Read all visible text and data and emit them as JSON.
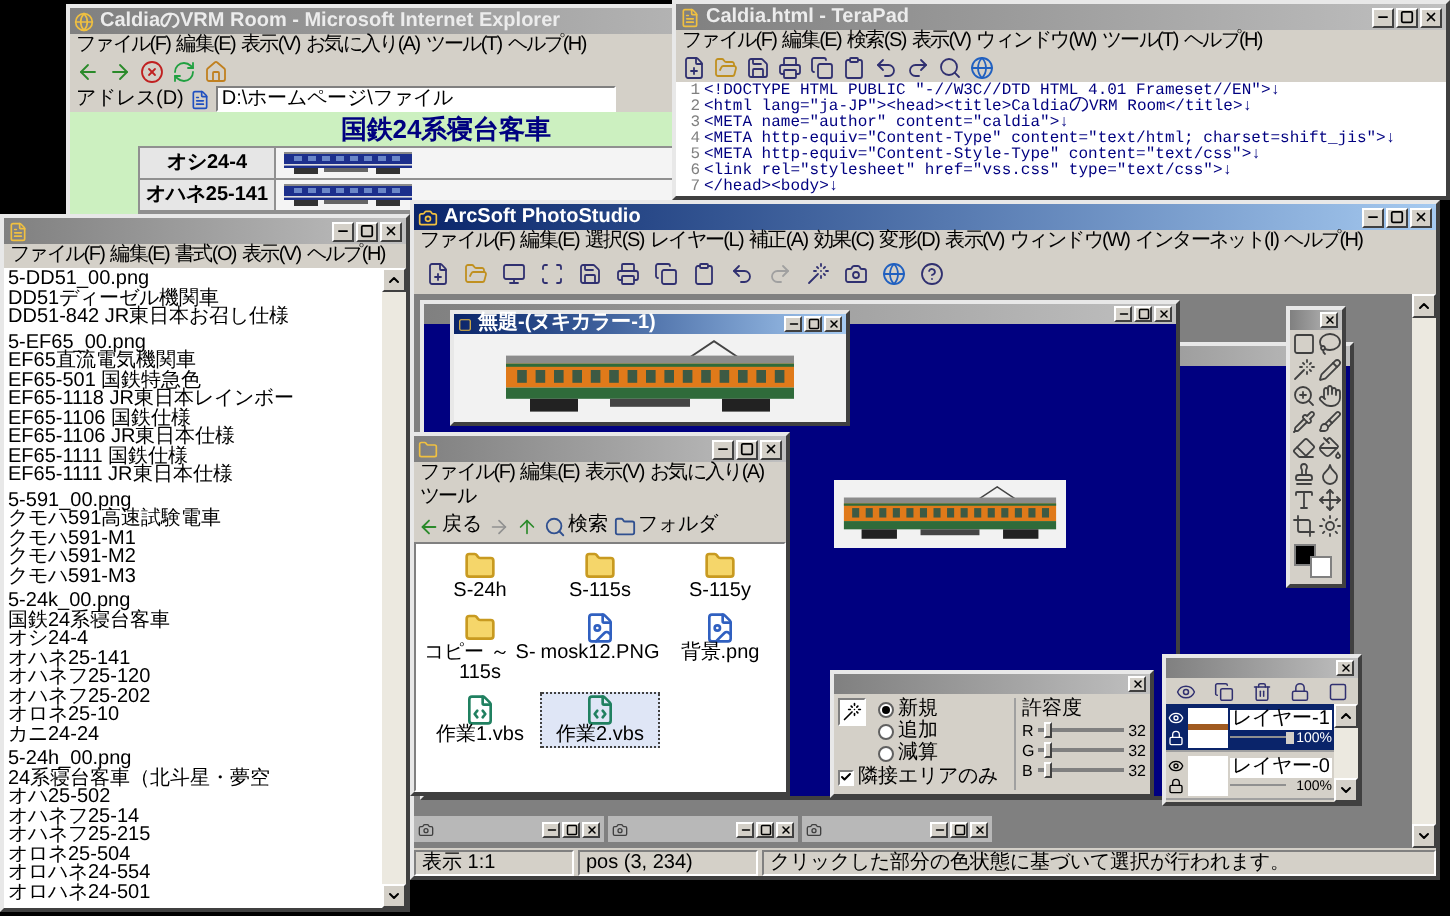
{
  "ie": {
    "title": "CaldiaのVRM Room - Microsoft Internet Explorer",
    "active": false,
    "menu": [
      "ファイル(F)",
      "編集(E)",
      "表示(V)",
      "お気に入り(A)",
      "ツール(T)",
      "ヘルプ(H)"
    ],
    "address_label": "アドレス(D)",
    "address": "D:\\ホームページ\\ファイル",
    "heading": "国鉄24系寝台客車",
    "rows": [
      {
        "label": "オシ24-4"
      },
      {
        "label": "オハネ25-141"
      }
    ]
  },
  "terapad": {
    "title": "Caldia.html - TeraPad",
    "active": false,
    "menu": [
      "ファイル(F)",
      "編集(E)",
      "検索(S)",
      "表示(V)",
      "ウィンドウ(W)",
      "ツール(T)",
      "ヘルプ(H)"
    ],
    "lines": [
      {
        "number": "1",
        "text": "<!DOCTYPE HTML PUBLIC \"-//W3C//DTD HTML 4.01 Frameset//EN\">↓"
      },
      {
        "number": "2",
        "text": "<html lang=\"ja-JP\"><head><title>CaldiaのVRM Room</title>↓"
      },
      {
        "number": "3",
        "text": "<META name=\"author\" content=\"caldia\">↓"
      },
      {
        "number": "4",
        "text": "<META http-equiv=\"Content-Type\" content=\"text/html; charset=shift_jis\">↓"
      },
      {
        "number": "5",
        "text": "<META http-equiv=\"Content-Style-Type\" content=\"text/css\">↓"
      },
      {
        "number": "6",
        "text": "<link rel=\"stylesheet\" href=\"vss.css\" type=\"text/css\">↓"
      },
      {
        "number": "7",
        "text": "</head><body>↓"
      }
    ]
  },
  "notepad": {
    "active": false,
    "menu": [
      "ファイル(F)",
      "編集(E)",
      "書式(O)",
      "表示(V)",
      "ヘルプ(H)"
    ],
    "sections": [
      [
        "5-DD51_00.png",
        "DD51ディーゼル機関車",
        "DD51-842 JR東日本お召し仕様"
      ],
      [
        "5-EF65_00.png",
        "EF65直流電気機関車",
        "EF65-501 国鉄特急色",
        "EF65-1118 JR東日本レインボー",
        "EF65-1106 国鉄仕様",
        "EF65-1106 JR東日本仕様",
        "EF65-1111 国鉄仕様",
        "EF65-1111 JR東日本仕様"
      ],
      [
        "5-591_00.png",
        "クモハ591高速試験電車",
        "クモハ591-M1",
        "クモハ591-M2",
        "クモハ591-M3"
      ],
      [
        "5-24k_00.png",
        "国鉄24系寝台客車",
        "オシ24-4",
        "オハネ25-141",
        "オハネフ25-120",
        "オハネフ25-202",
        "オロネ25-10",
        "カニ24-24"
      ],
      [
        "5-24h_00.png",
        "24系寝台客車（北斗星・夢空",
        "オハ25-502",
        "オハネフ25-14",
        "オハネフ25-215",
        "オロネ25-504",
        "オロハネ24-554",
        "オロハネ24-501"
      ]
    ]
  },
  "explorer": {
    "active": false,
    "menu": [
      "ファイル(F)",
      "編集(E)",
      "表示(V)",
      "お気に入り(A)",
      "ツール"
    ],
    "toolbar": [
      {
        "kind": "back",
        "label": "戻る"
      },
      {
        "kind": "search",
        "label": "検索"
      },
      {
        "kind": "folders",
        "label": "フォルダ"
      }
    ],
    "items": [
      {
        "kind": "folder",
        "label": "S-24h",
        "selected": false
      },
      {
        "kind": "folder",
        "label": "S-115s",
        "selected": false
      },
      {
        "kind": "folder",
        "label": "S-115y",
        "selected": false
      },
      {
        "kind": "folder",
        "label": "コピー ～ S-115s",
        "selected": false
      },
      {
        "kind": "image",
        "label": "mosk12.PNG",
        "selected": false
      },
      {
        "kind": "image",
        "label": "背景.png",
        "selected": false
      },
      {
        "kind": "script",
        "label": "作業1.vbs",
        "selected": false
      },
      {
        "kind": "script",
        "label": "作業2.vbs",
        "selected": true
      }
    ]
  },
  "photostudio": {
    "title": "ArcSoft PhotoStudio",
    "active": true,
    "menu": [
      "ファイル(F)",
      "編集(E)",
      "選択(S)",
      "レイヤー(L)",
      "補正(A)",
      "効果(C)",
      "変形(D)",
      "表示(V)",
      "ウィンドウ(W)",
      "インターネット(I)",
      "ヘルプ(H)"
    ],
    "image_window": {
      "title": "無題-(ヌキカラー-1)",
      "active": true
    },
    "wand_options": {
      "modes": [
        {
          "label": "新規",
          "selected": true
        },
        {
          "label": "追加",
          "selected": false
        },
        {
          "label": "減算",
          "selected": false
        }
      ],
      "adjacent": {
        "label": "隣接エリアのみ",
        "checked": true
      },
      "tolerance_label": "許容度",
      "channels": [
        {
          "name": "R",
          "level": 0.12,
          "reading": "32"
        },
        {
          "name": "G",
          "level": 0.12,
          "reading": "32"
        },
        {
          "name": "B",
          "level": 0.12,
          "reading": "32"
        }
      ]
    },
    "layers": [
      {
        "name": "レイヤー-1",
        "opacity": "100%",
        "level": 1,
        "selected": true
      },
      {
        "name": "レイヤー-0",
        "opacity": "100%",
        "level": 1,
        "selected": false
      }
    ],
    "status": {
      "zoom": "表示 1:1",
      "position": "pos (3, 234)",
      "message": "クリックした部分の色状態に基づいて選択が行われます。"
    }
  }
}
